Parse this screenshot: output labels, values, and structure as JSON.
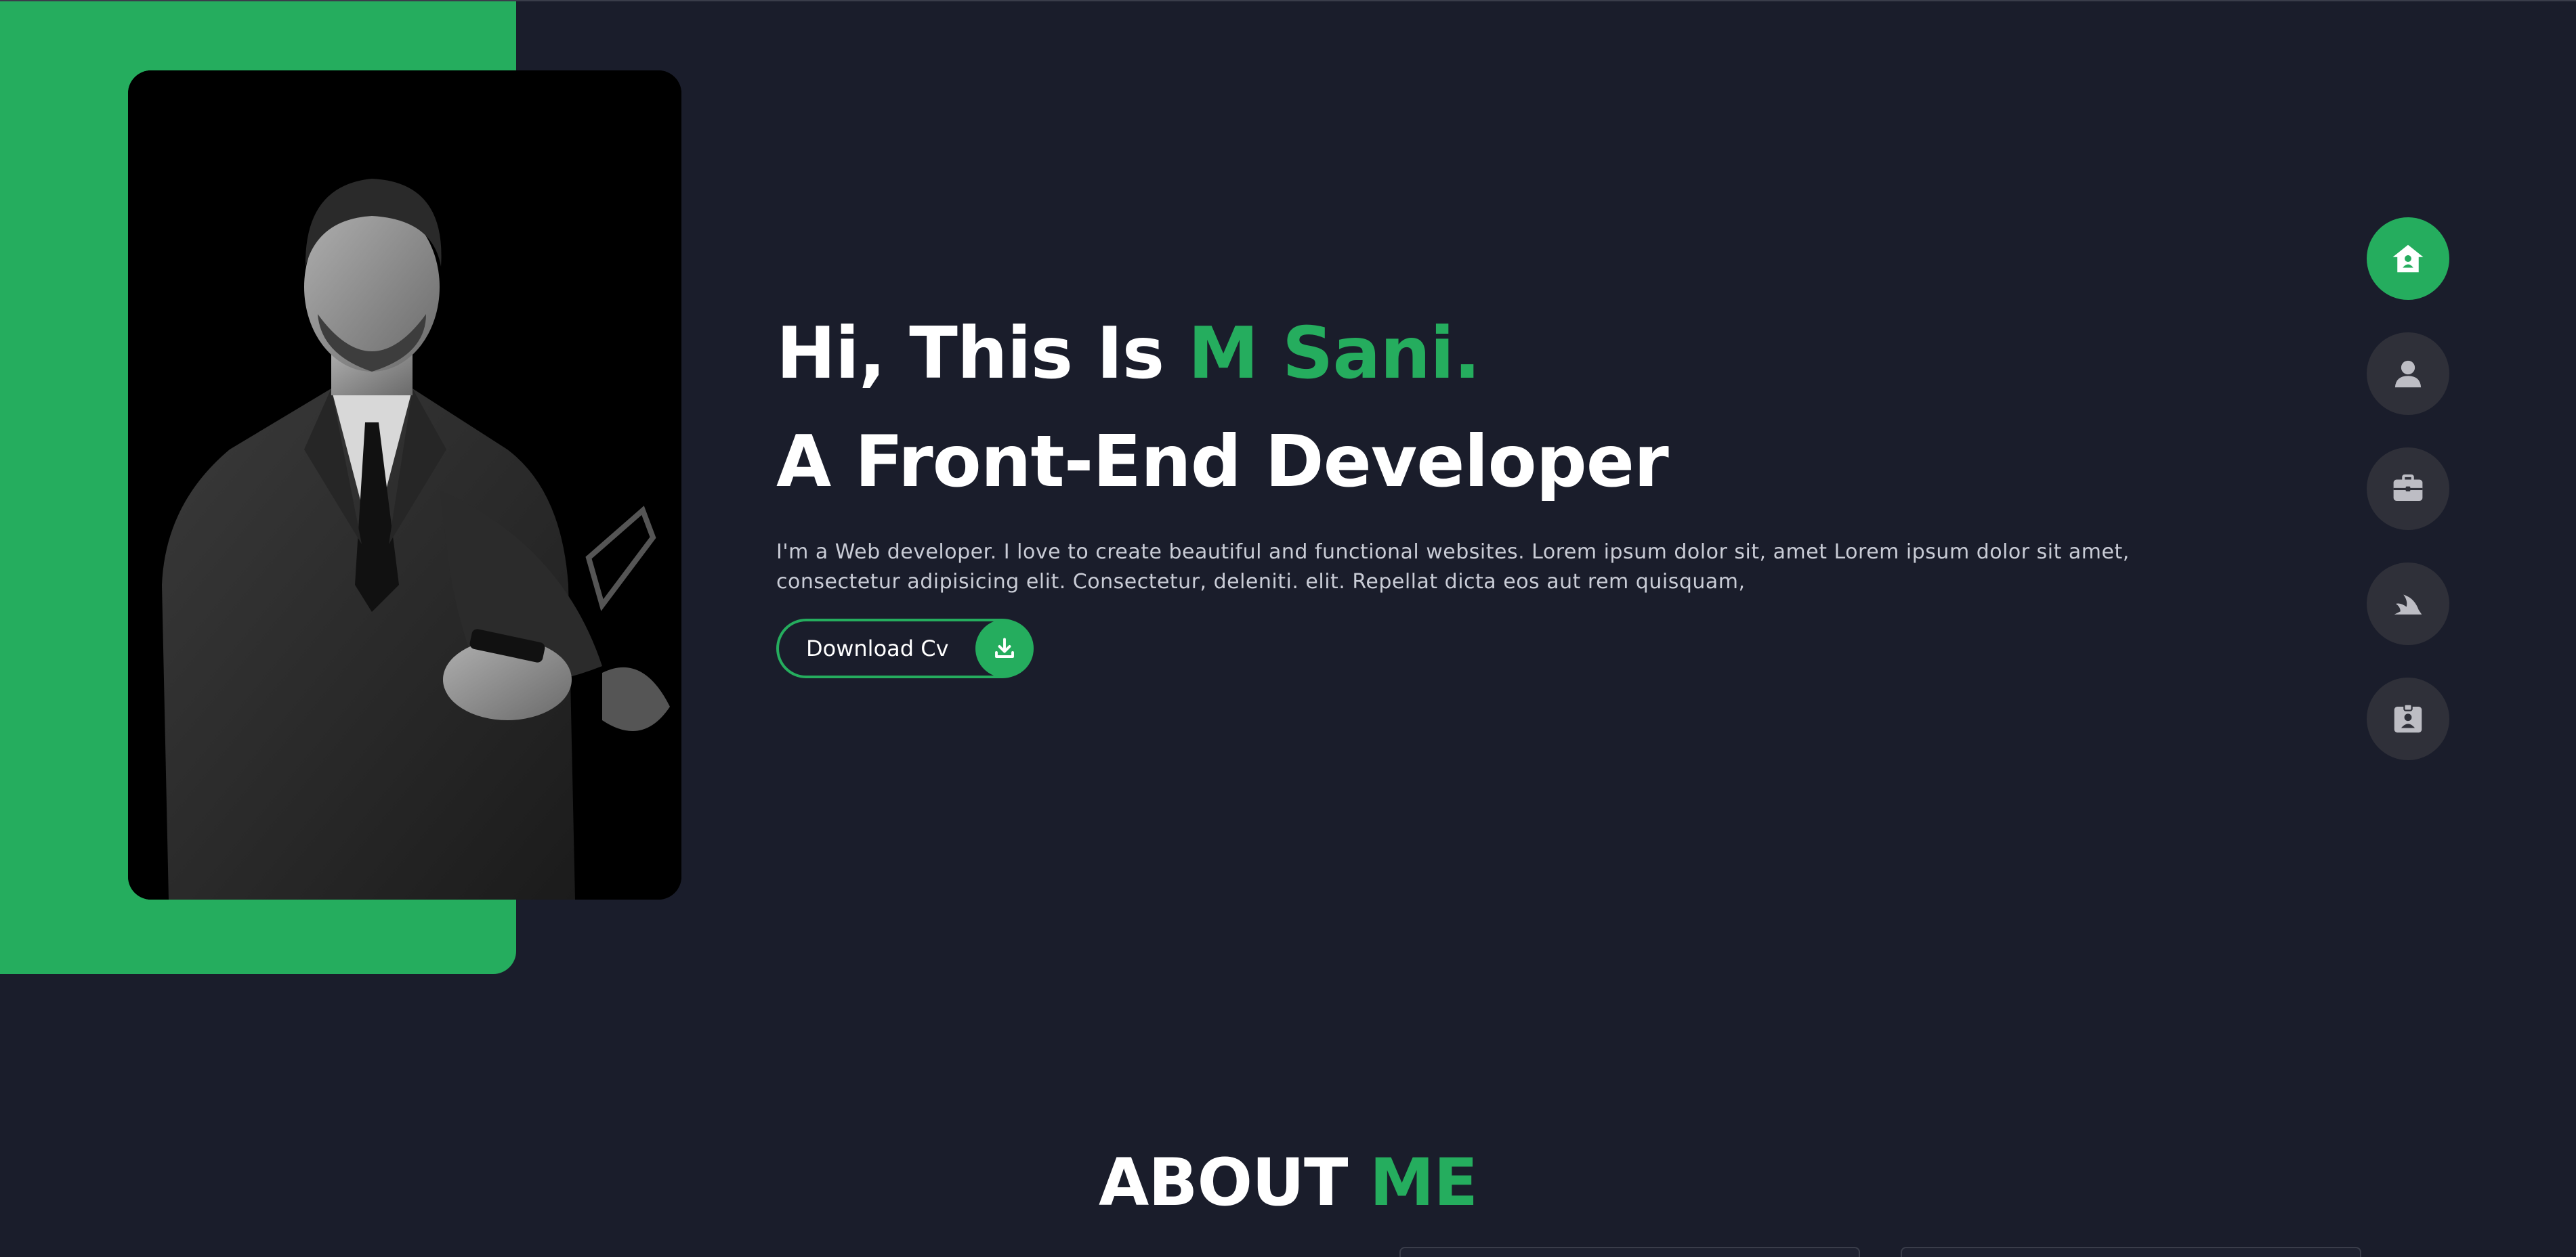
{
  "hero": {
    "greeting_prefix": "Hi, This Is ",
    "name": "M Sani.",
    "role": "A Front-End Developer",
    "description": "I'm a Web developer. I love to create beautiful and functional websites. Lorem ipsum dolor sit, amet Lorem ipsum dolor sit amet, consectetur adipisicing elit. Consectetur, deleniti. elit. Repellat dicta eos aut rem quisquam,",
    "download_label": "Download Cv",
    "download_icon": "download-icon"
  },
  "nav": {
    "items": [
      {
        "icon": "home-icon",
        "active": true
      },
      {
        "icon": "user-icon",
        "active": false
      },
      {
        "icon": "briefcase-icon",
        "active": false
      },
      {
        "icon": "blog-icon",
        "active": false
      },
      {
        "icon": "contact-card-icon",
        "active": false
      }
    ]
  },
  "about": {
    "title_white": "ABOUT ",
    "title_accent": "ME"
  },
  "colors": {
    "background": "#1a1d2b",
    "accent": "#25ad5e",
    "nav_inactive": "#2f3039",
    "text": "#ffffff"
  }
}
